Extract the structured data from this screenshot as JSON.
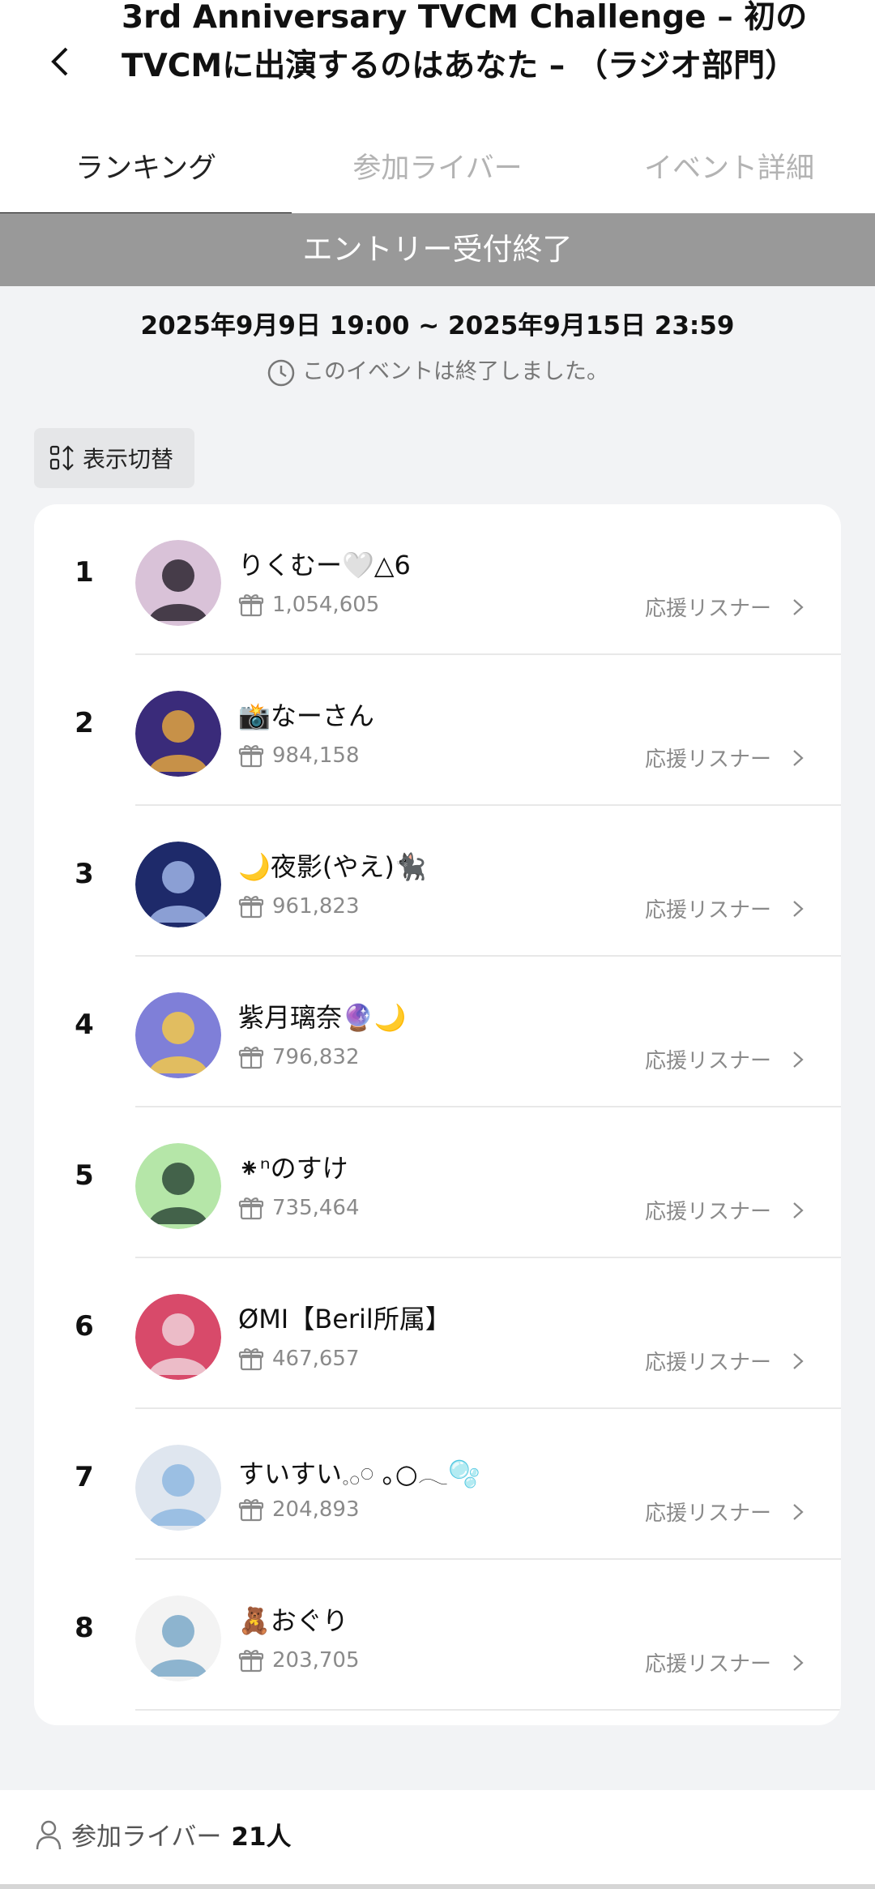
{
  "header": {
    "title": "3rd Anniversary TVCM Challenge – 初のTVCMに出演するのはあなた – （ラジオ部門）"
  },
  "tabs": [
    {
      "label": "ランキング",
      "active": true
    },
    {
      "label": "参加ライバー",
      "active": false
    },
    {
      "label": "イベント詳細",
      "active": false
    }
  ],
  "banner": {
    "text": "エントリー受付終了"
  },
  "event": {
    "period": "2025年9月9日 19:00 ~ 2025年9月15日 23:59",
    "status": "このイベントは終了しました。"
  },
  "toggle": {
    "label": "表示切替"
  },
  "ranking": {
    "listener_label": "応援リスナー",
    "items": [
      {
        "rank": "1",
        "name": "りくむー🤍△6",
        "score": "1,054,605",
        "avatar_colors": [
          "#d9c2d8",
          "#2c2430"
        ]
      },
      {
        "rank": "2",
        "name": "📸なーさん",
        "score": "984,158",
        "avatar_colors": [
          "#3a2b7a",
          "#e0a340"
        ]
      },
      {
        "rank": "3",
        "name": "🌙夜影(やえ)🐈‍⬛",
        "score": "961,823",
        "avatar_colors": [
          "#1e2a6a",
          "#9fb4e6"
        ]
      },
      {
        "rank": "4",
        "name": "紫月璃奈🔮🌙",
        "score": "796,832",
        "avatar_colors": [
          "#7f7fd8",
          "#f2c84b"
        ]
      },
      {
        "rank": "5",
        "name": "⁕ⁿのすけ",
        "score": "735,464",
        "avatar_colors": [
          "#b5e6a8",
          "#2f4a3a"
        ]
      },
      {
        "rank": "6",
        "name": "ØMI【Beril所属】",
        "score": "467,657",
        "avatar_colors": [
          "#d84a6a",
          "#f0d0d8"
        ]
      },
      {
        "rank": "7",
        "name": "すいすい𓈒𓂂𓏸 ｡○𓂃🫧",
        "score": "204,893",
        "avatar_colors": [
          "#dfe6ef",
          "#8fb7e0"
        ]
      },
      {
        "rank": "8",
        "name": "🧸おぐり",
        "score": "203,705",
        "avatar_colors": [
          "#f3f3f3",
          "#7aa8c8"
        ]
      }
    ]
  },
  "footer": {
    "label": "参加ライバー",
    "count": "21人"
  }
}
